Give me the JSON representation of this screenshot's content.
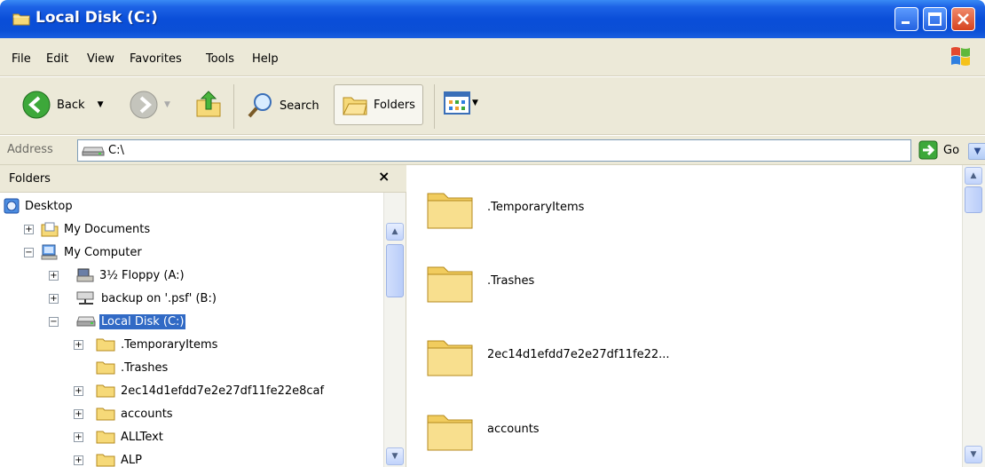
{
  "window": {
    "title": "Local Disk (C:)"
  },
  "menu": [
    {
      "label": "File"
    },
    {
      "label": "Edit"
    },
    {
      "label": "View"
    },
    {
      "label": "Favorites"
    },
    {
      "label": "Tools"
    },
    {
      "label": "Help"
    }
  ],
  "toolbar": {
    "back_label": "Back",
    "search_label": "Search",
    "folders_label": "Folders"
  },
  "address": {
    "label": "Address",
    "value": "C:\\",
    "go_label": "Go"
  },
  "folders_pane": {
    "title": "Folders",
    "close_glyph": "×",
    "tree": [
      {
        "label": "Desktop",
        "expander": ""
      },
      {
        "label": "My Documents",
        "expander": "+"
      },
      {
        "label": "My Computer",
        "expander": "−"
      },
      {
        "label": "3½ Floppy (A:)",
        "expander": "+"
      },
      {
        "label": "backup on '.psf' (B:)",
        "expander": "+"
      },
      {
        "label": "Local Disk (C:)",
        "expander": "−"
      },
      {
        "label": ".TemporaryItems",
        "expander": "+"
      },
      {
        "label": ".Trashes",
        "expander": ""
      },
      {
        "label": "2ec14d1efdd7e2e27df11fe22e8caf",
        "expander": "+"
      },
      {
        "label": "accounts",
        "expander": "+"
      },
      {
        "label": "ALLText",
        "expander": "+"
      },
      {
        "label": "ALP",
        "expander": "+"
      }
    ]
  },
  "content": {
    "items": [
      {
        "label": ".TemporaryItems"
      },
      {
        "label": ".Trashes"
      },
      {
        "label": "2ec14d1efdd7e2e27df11fe22..."
      },
      {
        "label": "accounts"
      }
    ]
  },
  "colors": {
    "titlebar": "#0b4fd6",
    "chrome": "#ece9d8",
    "selection": "#316ac5",
    "folder": "#f6d978"
  }
}
